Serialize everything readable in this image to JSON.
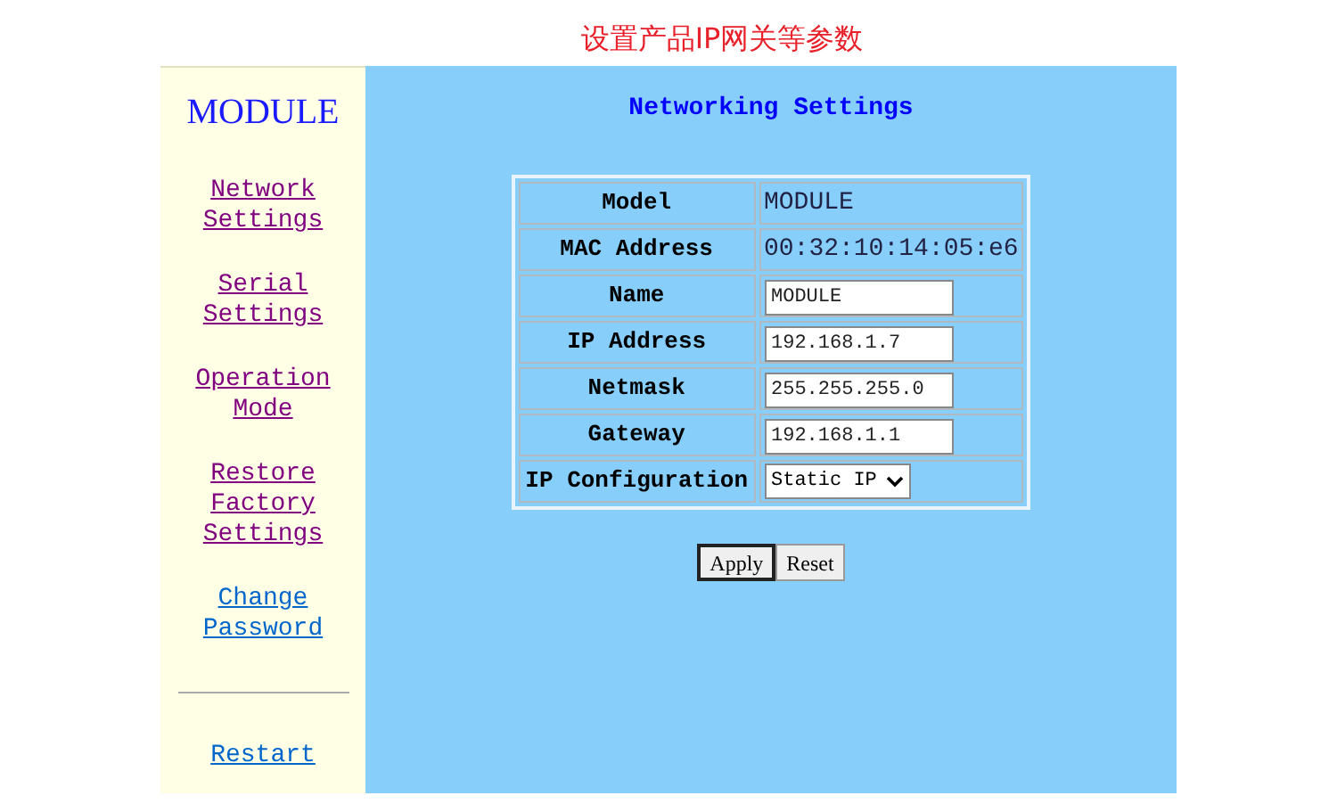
{
  "caption": "设置产品IP网关等参数",
  "sidebar": {
    "title": "MODULE",
    "links": [
      {
        "label": "Network Settings",
        "visited": true
      },
      {
        "label": "Serial Settings",
        "visited": true
      },
      {
        "label": "Operation Mode",
        "visited": true
      },
      {
        "label": "Restore Factory Settings",
        "visited": true
      },
      {
        "label": "Change Password",
        "visited": false
      }
    ],
    "bottom_links": [
      {
        "label": "Restart",
        "visited": false
      }
    ]
  },
  "main": {
    "title": "Networking Settings",
    "rows": [
      {
        "label": "Model",
        "kind": "text",
        "value": "MODULE"
      },
      {
        "label": "MAC Address",
        "kind": "text",
        "value": "00:32:10:14:05:e6"
      },
      {
        "label": "Name",
        "kind": "input",
        "value": "MODULE"
      },
      {
        "label": "IP Address",
        "kind": "input",
        "value": "192.168.1.7"
      },
      {
        "label": "Netmask",
        "kind": "input",
        "value": "255.255.255.0"
      },
      {
        "label": "Gateway",
        "kind": "input",
        "value": "192.168.1.1"
      },
      {
        "label": "IP Configuration",
        "kind": "select",
        "value": "Static IP"
      }
    ],
    "buttons": [
      {
        "label": "Apply",
        "focused": true
      },
      {
        "label": "Reset",
        "focused": false
      }
    ]
  }
}
